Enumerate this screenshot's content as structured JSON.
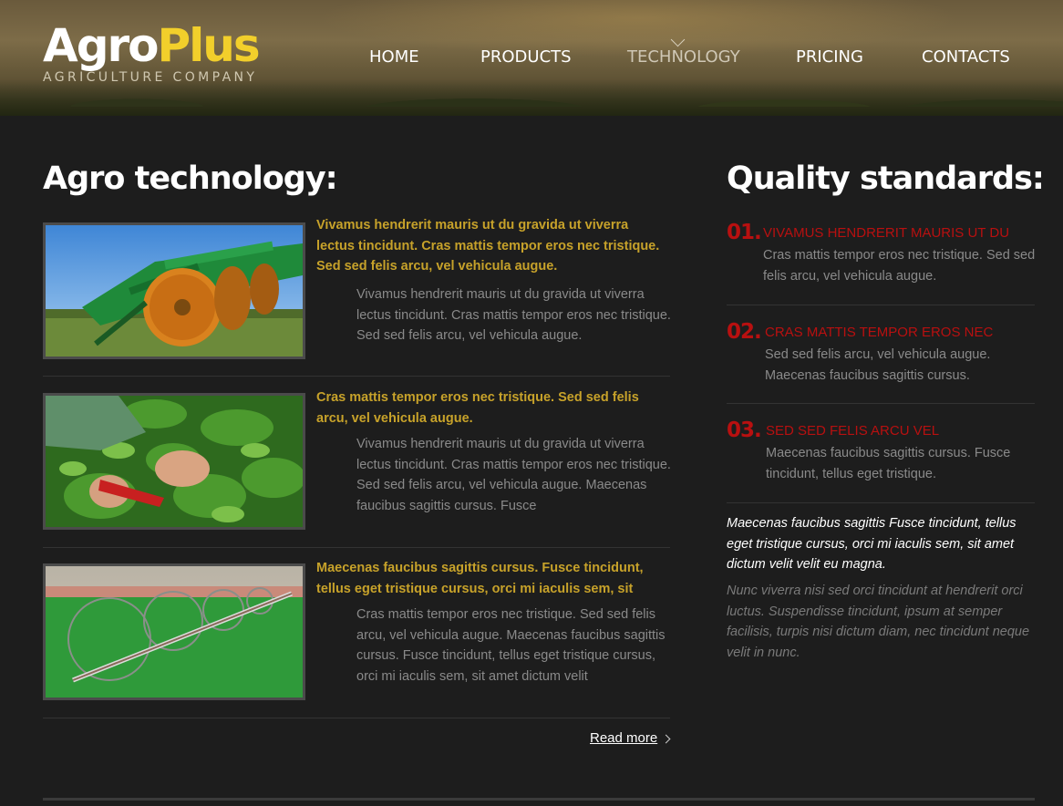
{
  "brand": {
    "name_part1": "Agro",
    "name_part2": "Plus",
    "tagline": "AGRICULTURE COMPANY"
  },
  "nav": {
    "items": [
      {
        "label": "HOME"
      },
      {
        "label": "PRODUCTS"
      },
      {
        "label": "TECHNOLOGY",
        "active": true
      },
      {
        "label": "PRICING"
      },
      {
        "label": "CONTACTS"
      }
    ]
  },
  "main": {
    "title": "Agro technology:",
    "articles": [
      {
        "image": "disc-harrow-tractor",
        "headline": "Vivamus hendrerit mauris ut du gravida ut viverra lectus tincidunt. Cras mattis tempor eros nec tristique. Sed sed felis arcu, vel vehicula augue.",
        "body": "Vivamus hendrerit mauris ut du gravida ut viverra lectus tincidunt. Cras mattis tempor eros nec tristique. Sed sed felis arcu, vel vehicula augue."
      },
      {
        "image": "hands-pruning-plants",
        "headline": "Cras mattis tempor eros nec tristique. Sed sed felis arcu, vel vehicula augue.",
        "body": "Vivamus hendrerit mauris ut du gravida ut viverra lectus tincidunt. Cras mattis tempor eros nec tristique. Sed sed felis arcu, vel vehicula augue. Maecenas faucibus sagittis cursus. Fusce"
      },
      {
        "image": "irrigation-wheel-line",
        "headline": "Maecenas faucibus sagittis cursus. Fusce tincidunt, tellus eget tristique cursus, orci mi iaculis sem, sit",
        "body": "Cras mattis tempor eros nec tristique. Sed sed felis arcu, vel vehicula augue. Maecenas faucibus sagittis cursus. Fusce tincidunt, tellus eget tristique cursus, orci mi iaculis sem, sit amet dictum velit"
      }
    ],
    "read_more": "Read more"
  },
  "sidebar": {
    "title": "Quality standards:",
    "standards": [
      {
        "number": "01.",
        "title": "VIVAMUS HENDRERIT MAURIS UT DU",
        "text": "Cras mattis tempor eros nec tristique. Sed sed felis arcu, vel vehicula augue."
      },
      {
        "number": "02.",
        "title": "CRAS MATTIS TEMPOR EROS NEC",
        "text": "Sed sed felis arcu, vel vehicula augue. Maecenas faucibus sagittis cursus."
      },
      {
        "number": "03.",
        "title": "SED SED FELIS ARCU VEL",
        "text": "Maecenas faucibus sagittis cursus. Fusce tincidunt, tellus eget tristique."
      }
    ],
    "quote_highlight": "Maecenas faucibus sagittis Fusce tincidunt, tellus eget tristique cursus, orci mi iaculis sem, sit amet dictum velit velit eu magna.",
    "quote_muted": "Nunc viverra nisi sed orci tincidunt at hendrerit orci luctus. Suspendisse tincidunt, ipsum at semper facilisis, turpis nisi dictum diam, nec tincidunt neque velit in nunc."
  },
  "colors": {
    "accent_yellow": "#f2cf2b",
    "headline_gold": "#c7a22a",
    "standard_red": "#b81010",
    "background": "#1d1d1d"
  }
}
